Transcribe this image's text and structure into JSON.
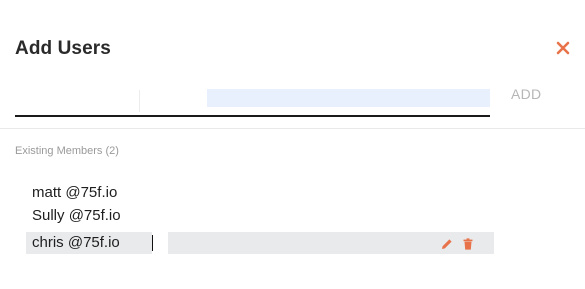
{
  "dialog": {
    "title": "Add Users"
  },
  "add_input": {
    "value": "",
    "placeholder": ""
  },
  "add_button_label": "ADD",
  "members": {
    "heading": "Existing Members (2)",
    "items": [
      {
        "name": "matt",
        "domain": "@75f.io"
      },
      {
        "name": "Sully",
        "domain": "@75f.io"
      },
      {
        "name": "chris",
        "domain": "@75f.io"
      }
    ]
  },
  "colors": {
    "accent": "#e8734a",
    "selected_row": "#e9eaec",
    "input_highlight": "#e8effd"
  },
  "icons": {
    "close": "close-icon",
    "edit": "pencil-icon",
    "delete": "trash-icon"
  }
}
